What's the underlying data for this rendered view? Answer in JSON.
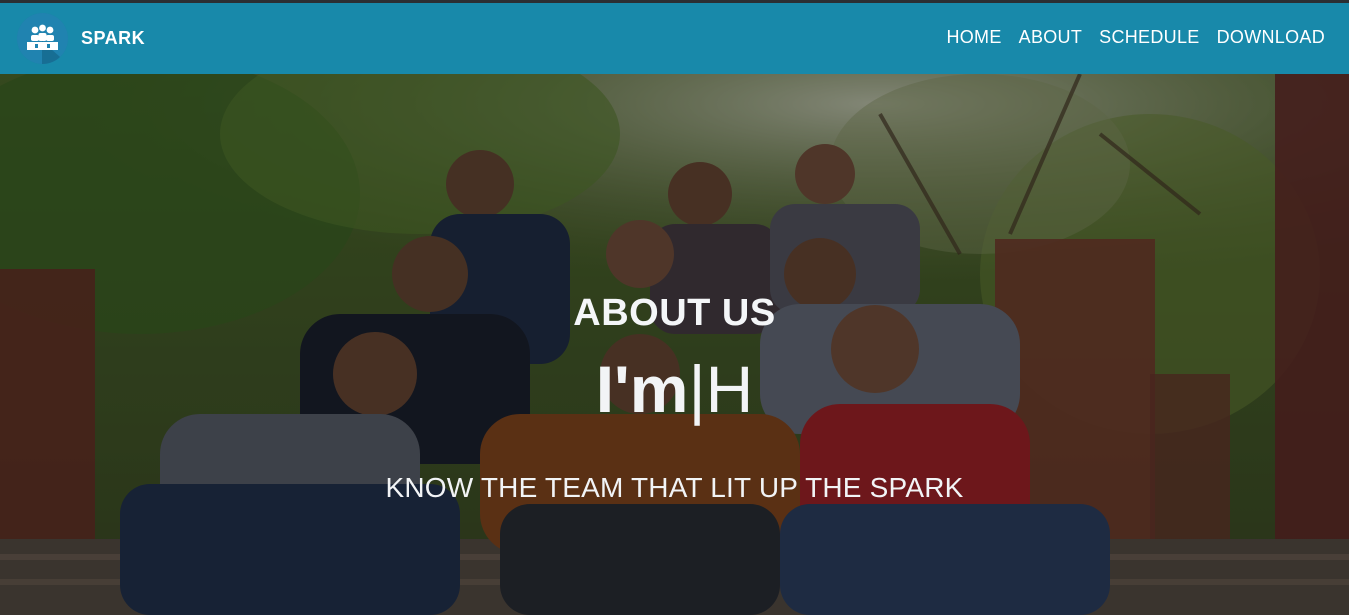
{
  "navbar": {
    "brand": "SPARK",
    "links": [
      {
        "label": "HOME"
      },
      {
        "label": "ABOUT"
      },
      {
        "label": "SCHEDULE"
      },
      {
        "label": "DOWNLOAD"
      }
    ],
    "background_color": "#1889aa",
    "logo_icon": "podium-people-icon"
  },
  "hero": {
    "title": "ABOUT US",
    "typed_prefix": "I'm",
    "typed_cursor": "|",
    "typed_text": "H",
    "tagline": "KNOW THE TEAM THAT LIT UP THE SPARK",
    "background": "team-group-photo"
  }
}
